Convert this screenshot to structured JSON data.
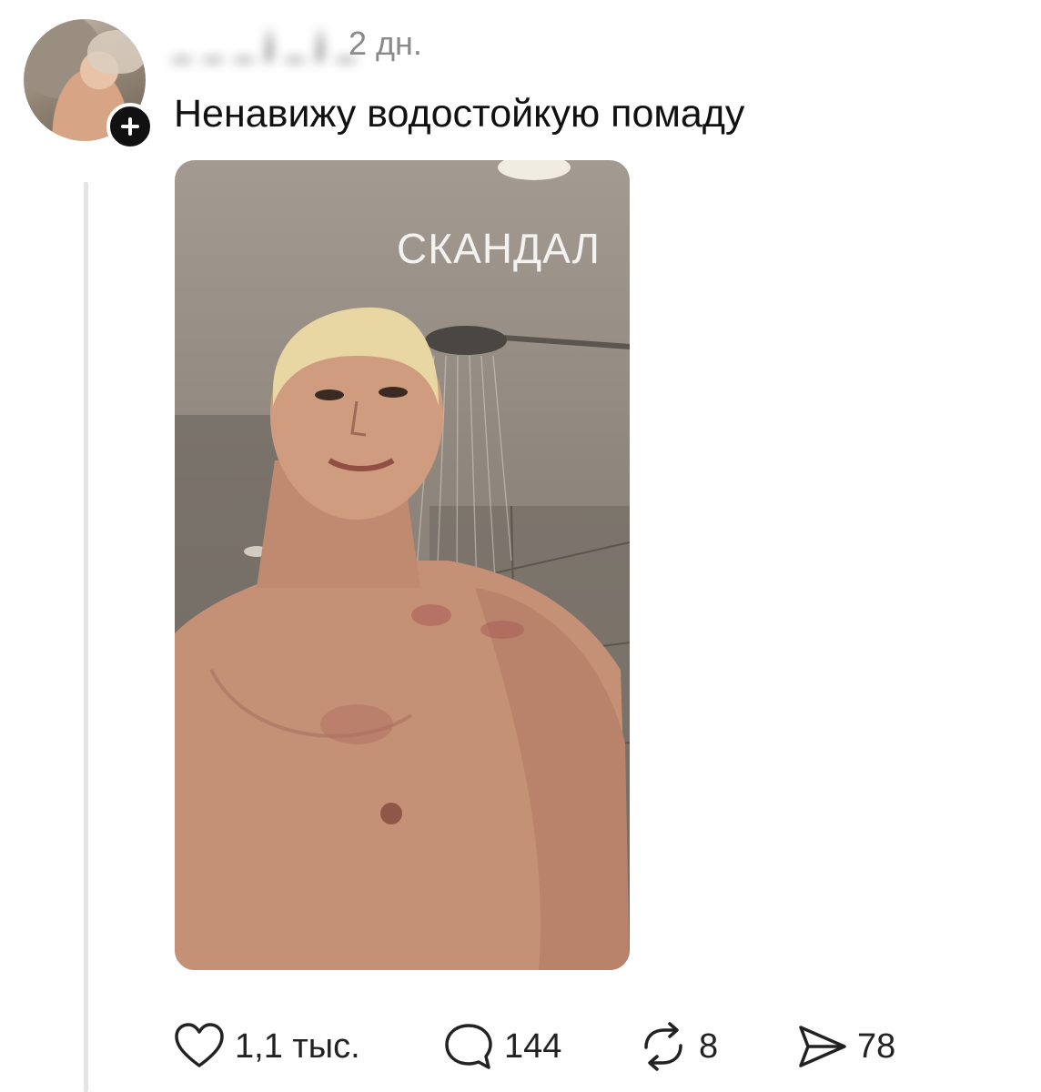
{
  "post": {
    "username": "_ _ _ j _ j _",
    "time": "2 дн.",
    "text": "Ненавижу водостойкую помаду",
    "media": {
      "overlay_text": "СКАНДАЛ"
    }
  },
  "actions": {
    "likes": "1,1 тыс.",
    "comments": "144",
    "reposts": "8",
    "shares": "78"
  },
  "icons": {
    "like": "heart-icon",
    "comment": "speech-bubble-icon",
    "repost": "repost-arrows-icon",
    "share": "paper-plane-icon",
    "follow": "plus-icon"
  }
}
